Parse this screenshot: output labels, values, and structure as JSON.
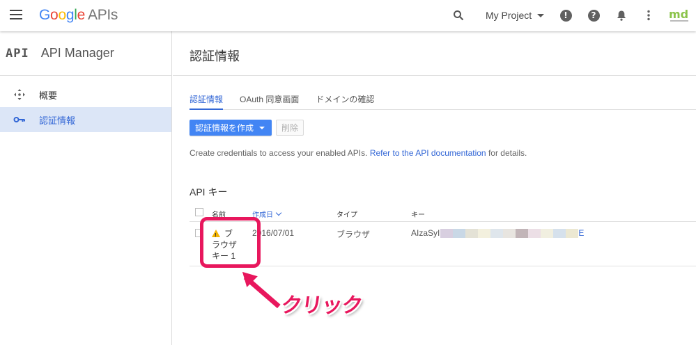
{
  "header": {
    "logo_letters": [
      "G",
      "o",
      "o",
      "g",
      "l",
      "e"
    ],
    "logo_suffix": "APIs",
    "project_name": "My Project",
    "feedback_glyph": "!",
    "help_glyph": "?",
    "brand_mark_text": "md"
  },
  "sidebar": {
    "api_mark": "API",
    "title": "API Manager",
    "items": [
      {
        "label": "概要",
        "icon": "move-icon"
      },
      {
        "label": "認証情報",
        "icon": "key-icon",
        "active": true
      }
    ]
  },
  "main": {
    "page_title": "認証情報",
    "tabs": [
      {
        "label": "認証情報",
        "active": true
      },
      {
        "label": "OAuth 同意画面"
      },
      {
        "label": "ドメインの確認"
      }
    ],
    "create_button": "認証情報を作成",
    "delete_button": "削除",
    "description": {
      "before": "Create credentials to access your enabled APIs.",
      "link": "Refer to the API documentation",
      "after": "for details."
    },
    "section_title": "API キー",
    "table": {
      "headers": {
        "name": "名前",
        "created": "作成日",
        "type": "タイプ",
        "key": "キー"
      },
      "rows": [
        {
          "name_line1": "ブ",
          "name_line2": "ラウザ",
          "name_line3": "キー 1",
          "created": "2016/07/01",
          "type": "ブラウザ",
          "key_prefix": "AIzaSyI",
          "key_suffix": "E"
        }
      ]
    }
  },
  "annotation": {
    "label": "クリック",
    "color": "#e8175d"
  },
  "colors": {
    "accent": "#4285f4",
    "link": "#3367d6",
    "active_bg": "#dce6f7"
  }
}
